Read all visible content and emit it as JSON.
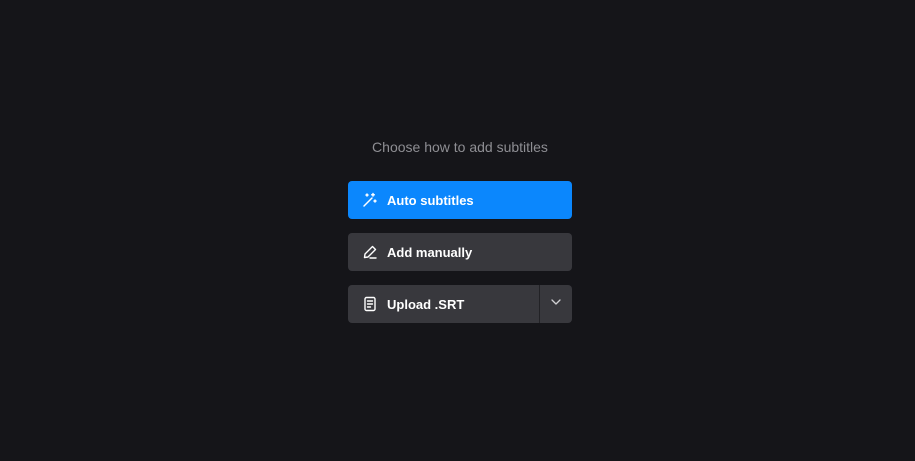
{
  "prompt": "Choose how to add subtitles",
  "buttons": {
    "auto": {
      "label": "Auto subtitles",
      "icon": "magic-wand-icon"
    },
    "manual": {
      "label": "Add manually",
      "icon": "pencil-icon"
    },
    "upload": {
      "label": "Upload .SRT",
      "icon": "document-icon",
      "menu_icon": "chevron-down-icon"
    }
  },
  "colors": {
    "background": "#151519",
    "primary": "#0b87fd",
    "secondary": "#38383d",
    "prompt_text": "#8e8e93"
  }
}
